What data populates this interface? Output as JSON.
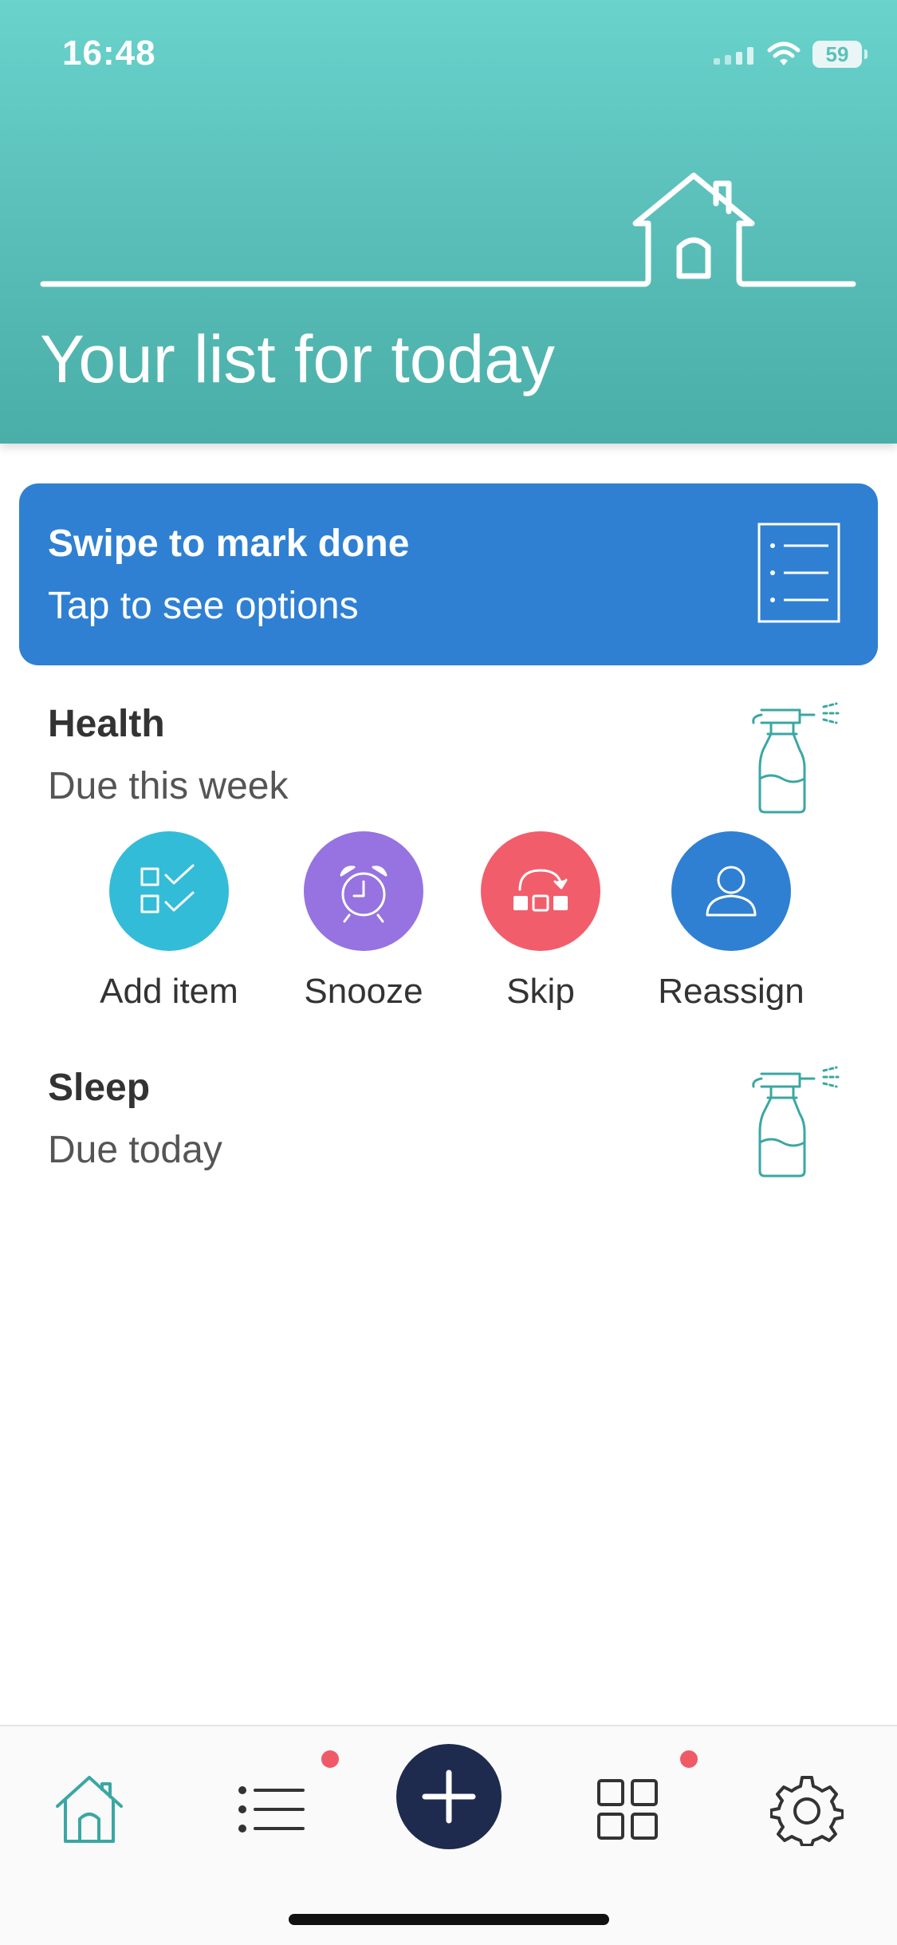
{
  "status_bar": {
    "time": "16:48",
    "battery": "59"
  },
  "header": {
    "title": "Your list for today"
  },
  "banner": {
    "line1": "Swipe to mark done",
    "line2": "Tap to see options",
    "icon": "list-icon"
  },
  "tasks": [
    {
      "title": "Health",
      "due": "Due this week",
      "icon": "spray-bottle-icon"
    },
    {
      "title": "Sleep",
      "due": "Due today",
      "icon": "spray-bottle-icon"
    }
  ],
  "actions": [
    {
      "label": "Add item",
      "icon": "checklist-icon",
      "color": "#33bcd8"
    },
    {
      "label": "Snooze",
      "icon": "alarm-clock-icon",
      "color": "#9673e0"
    },
    {
      "label": "Skip",
      "icon": "skip-icon",
      "color": "#f25d6b"
    },
    {
      "label": "Reassign",
      "icon": "person-icon",
      "color": "#2f80d2"
    }
  ],
  "nav": {
    "items": [
      {
        "name": "home",
        "icon": "home-icon",
        "active": true,
        "badge": false
      },
      {
        "name": "list",
        "icon": "list-icon",
        "active": false,
        "badge": true
      },
      {
        "name": "add",
        "icon": "plus-icon",
        "active": false,
        "badge": false
      },
      {
        "name": "grid",
        "icon": "grid-icon",
        "active": false,
        "badge": true
      },
      {
        "name": "settings",
        "icon": "gear-icon",
        "active": false,
        "badge": false
      }
    ]
  },
  "colors": {
    "header_teal": "#5cc0bb",
    "banner_blue": "#2f80d2",
    "accent_teal": "#3aa7a3",
    "nav_dark": "#1e2b4e",
    "badge_red": "#f05a67"
  }
}
